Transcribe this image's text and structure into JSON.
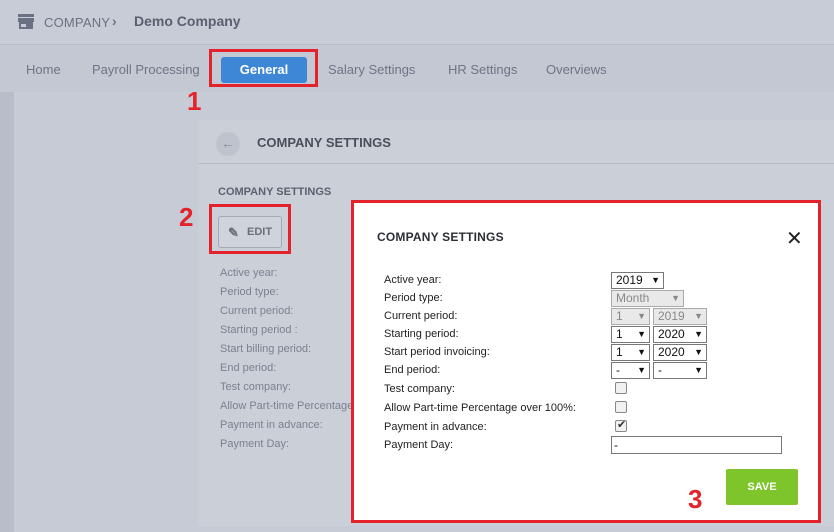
{
  "breadcrumb": {
    "company": "COMPANY",
    "separator": "›",
    "current": "Demo Company"
  },
  "nav": {
    "items": [
      "Home",
      "Payroll Processing",
      "General",
      "Salary Settings",
      "HR Settings",
      "Overviews"
    ],
    "active": "General"
  },
  "panel": {
    "back_icon": "←",
    "title": "COMPANY SETTINGS",
    "section_title": "COMPANY SETTINGS",
    "edit_label": "EDIT",
    "fields": [
      "Active year:",
      "Period type:",
      "Current period:",
      "Starting period :",
      "Start billing period:",
      "End period:",
      "Test company:",
      "Allow Part-time Percentage",
      "Payment in advance:",
      "Payment Day:"
    ]
  },
  "annotations": {
    "n1": "1",
    "n2": "2",
    "n3": "3",
    "color": "#e3222b"
  },
  "modal": {
    "title": "COMPANY SETTINGS",
    "close_icon": "✕",
    "labels": {
      "active_year": "Active year:",
      "period_type": "Period type:",
      "current_period": "Current period:",
      "starting_period": "Starting period:",
      "start_period_invoicing": "Start period invoicing:",
      "end_period": "End period:",
      "test_company": "Test company:",
      "allow_part_time": "Allow Part-time Percentage over 100%:",
      "payment_in_advance": "Payment in advance:",
      "payment_day": "Payment Day:"
    },
    "values": {
      "active_year": "2019",
      "period_type": "Month",
      "current_period_num": "1",
      "current_period_year": "2019",
      "starting_period_num": "1",
      "starting_period_year": "2020",
      "invoicing_num": "1",
      "invoicing_year": "2020",
      "end_period_num": "-",
      "end_period_year": "-",
      "test_company": false,
      "allow_part_time": false,
      "payment_in_advance": true,
      "payment_day": "-"
    },
    "caret": "▼",
    "save_label": "SAVE",
    "save_color": "#7dc52a"
  },
  "accent": "#3e87d6"
}
